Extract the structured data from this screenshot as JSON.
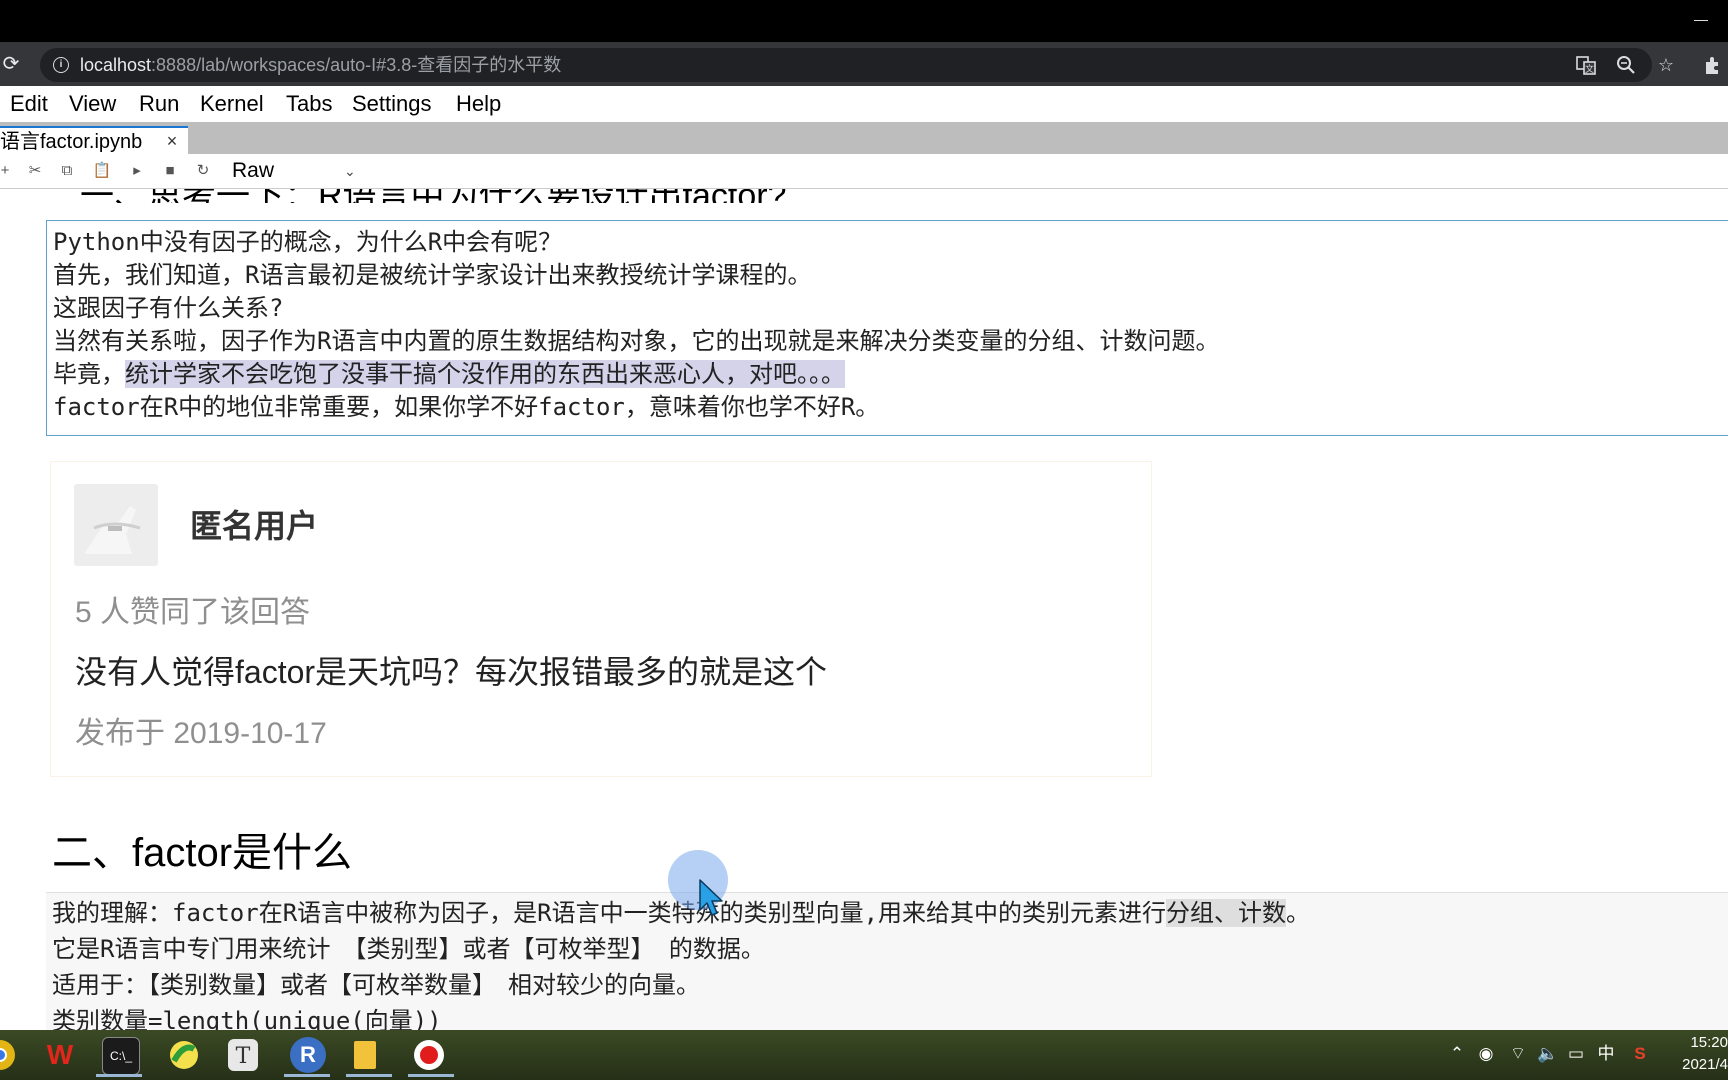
{
  "browser": {
    "url_host": "localhost",
    "url_rest": ":8888/lab/workspaces/auto-I#3.8-查看因子的水平数",
    "icons": [
      "reload-icon",
      "info-icon",
      "translate-icon",
      "zoom-icon",
      "star-icon",
      "extensions-icon"
    ]
  },
  "menu": [
    "Edit",
    "View",
    "Run",
    "Kernel",
    "Tabs",
    "Settings",
    "Help"
  ],
  "tab": {
    "label": "语言factor.ipynb",
    "close": "×"
  },
  "toolbar": {
    "cell_type": "Raw",
    "icons": [
      "add-icon",
      "cut-icon",
      "copy-icon",
      "paste-icon",
      "run-icon",
      "stop-icon",
      "restart-icon"
    ]
  },
  "notebook": {
    "cut_heading": "一、思考一下：R语言中为什么要设计出factor?",
    "cell1": {
      "line1": "Python中没有因子的概念，为什么R中会有呢？",
      "line2": "首先，我们知道，R语言最初是被统计学家设计出来教授统计学课程的。",
      "line3": "这跟因子有什么关系?",
      "line4": "当然有关系啦，因子作为R语言中内置的原生数据结构对象，它的出现就是来解决分类变量的分组、计数问题。",
      "line5_plain": "毕竟，",
      "line5_highlight": "统计学家不会吃饱了没事干搞个没作用的东西出来恶心人，对吧。。。",
      "line6": "factor在R中的地位非常重要，如果你学不好factor，意味着你也学不好R。"
    },
    "card": {
      "username": "匿名用户",
      "likes": "5 人赞同了该回答",
      "answer": "没有人觉得factor是天坑吗？每次报错最多的就是这个",
      "date": "发布于 2019-10-17"
    },
    "heading2": "二、factor是什么",
    "cell2": {
      "line1_a": "我的理解：factor在R语言中被称为因子，是R语言中一类特殊的类别型向量,用来给其中的类别元素进行",
      "line1_hl": "分组、计数",
      "line1_b": "。",
      "line2": "它是R语言中专门用来统计　【类别型】或者【可枚举型】 的数据。",
      "line3": "适用于：【类别数量】或者【可枚举数量】　相对较少的向量。",
      "line4": "类别数量=length(unique(向量))"
    }
  },
  "taskbar": {
    "apps": [
      {
        "name": "chrome",
        "glyph": "●",
        "color": "#e2b514"
      },
      {
        "name": "wps",
        "glyph": "W",
        "color": "#c8261c"
      },
      {
        "name": "terminal",
        "glyph": "▭",
        "color": "#1d1d1d"
      },
      {
        "name": "app-green",
        "glyph": "●",
        "color": "#7ac943"
      },
      {
        "name": "typora",
        "glyph": "T",
        "color": "#e8e8e8"
      },
      {
        "name": "r",
        "glyph": "R",
        "color": "#2a6fd0"
      },
      {
        "name": "files",
        "glyph": "▮",
        "color": "#f2c23a"
      },
      {
        "name": "recorder",
        "glyph": "●",
        "color": "#e01c1c"
      }
    ],
    "tray": [
      "^",
      "◉",
      "≋",
      "🔊",
      "▭",
      "中",
      "S"
    ],
    "time": "15:20",
    "date": "2021/4"
  }
}
